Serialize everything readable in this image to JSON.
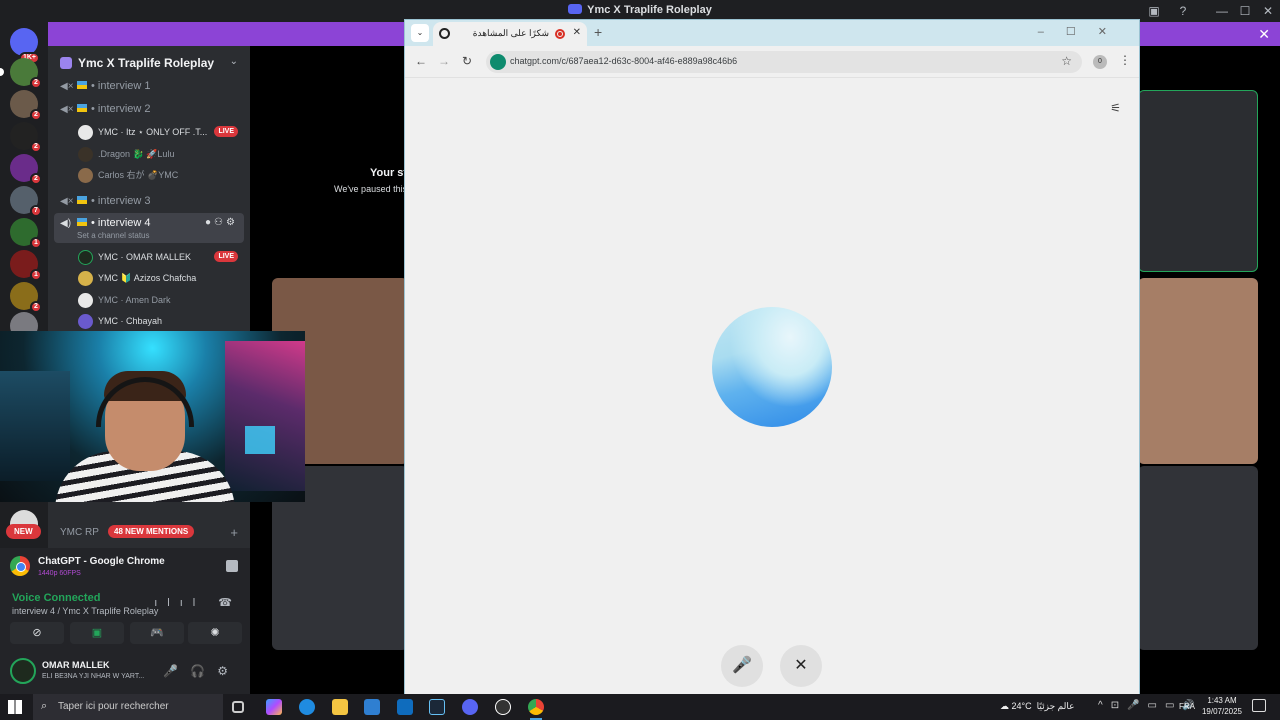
{
  "discord": {
    "window_title": "Ymc X Traplife Roleplay",
    "server_name": "Ymc X Traplife Roleplay",
    "rail": {
      "top_badge": "1K+",
      "servers": [
        {
          "badge": "2"
        },
        {
          "badge": "2"
        },
        {
          "badge": "2"
        },
        {
          "badge": "2"
        },
        {
          "badge": "7"
        },
        {
          "badge": "1"
        },
        {
          "badge": "1"
        },
        {
          "badge": "2"
        },
        {
          "badge": ""
        }
      ]
    },
    "channels": [
      {
        "name": "interview 1"
      },
      {
        "name": "interview 2"
      },
      {
        "name": "interview 3"
      },
      {
        "name": "interview 4",
        "status": "Set a channel status"
      }
    ],
    "interview2_members": [
      {
        "name": "YMC · Itz ⋆ ONLY OFF .T...",
        "live": "LIVE"
      },
      {
        "name": ".Dragon 🐉  🚀Lulu"
      },
      {
        "name": "Carlos 右が  💣YMC"
      }
    ],
    "interview4_members": [
      {
        "name": "YMC · OMAR MALLEK",
        "live": "LIVE"
      },
      {
        "name": "YMC 🔰 Azizos Chafcha"
      },
      {
        "name": "YMC · Amen Dark"
      },
      {
        "name": "YMC · Chbayah"
      }
    ],
    "bottom_bar": {
      "new_label": "NEW",
      "mentions_label": "48 NEW MENTIONS",
      "channel_hint": "YMC RP"
    },
    "stream": {
      "title": "ChatGPT - Google Chrome",
      "quality": "1440p 60FPS"
    },
    "voice": {
      "status": "Voice Connected",
      "channel": "interview 4 / Ymc X Traplife Roleplay"
    },
    "user": {
      "name": "OMAR MALLEK",
      "status": "ELI BE3NA YJI NHAR W YART..."
    },
    "stage": {
      "paused_title": "Your st",
      "paused_sub": "We've paused this"
    }
  },
  "chrome": {
    "tab_title": "شكرًا على المشاهدة",
    "url": "chatgpt.com/c/687aea12-d63c-8004-af46-e889a98c46b6",
    "profile_initial": "0"
  },
  "taskbar": {
    "search_placeholder": "Taper ici pour rechercher",
    "temperature": "24°C",
    "weather_text": "عالم جزئيًا",
    "language": "FRA",
    "time": "1:43 AM",
    "date": "19/07/2025"
  },
  "colors": {
    "discord_bg": "#1e1f22",
    "sidebar": "#2b2d31",
    "banner": "#8c44d6",
    "live_red": "#da373c",
    "voice_green": "#23a55a",
    "chrome_tabstrip": "#cfe6ee"
  }
}
